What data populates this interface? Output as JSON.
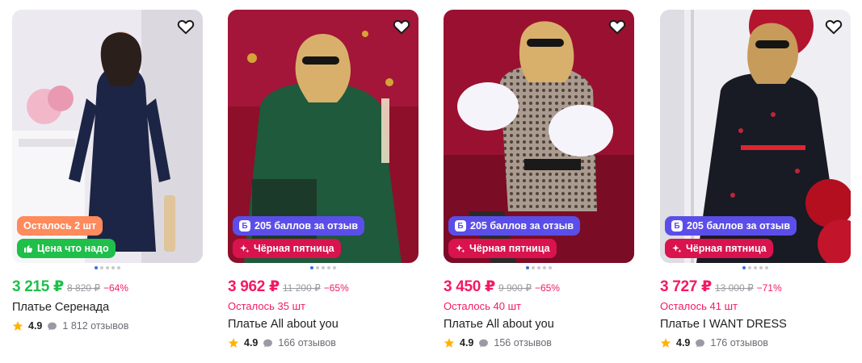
{
  "products": [
    {
      "price": "3 215 ₽",
      "old_price": "8 820 ₽",
      "discount": "−64%",
      "stock_note": "",
      "title": "Платье Серенада",
      "rating": "4.9",
      "reviews": "1 812 отзывов",
      "badges": [
        "Осталось 2 шт",
        "Цена что надо"
      ]
    },
    {
      "price": "3 962 ₽",
      "old_price": "11 200 ₽",
      "discount": "−65%",
      "stock_note": "Осталось 35 шт",
      "title": "Платье All about you",
      "rating": "4.9",
      "reviews": "166 отзывов",
      "badges": [
        "205 баллов за отзыв",
        "Чёрная пятница"
      ]
    },
    {
      "price": "3 450 ₽",
      "old_price": "9 900 ₽",
      "discount": "−65%",
      "stock_note": "Осталось 40 шт",
      "title": "Платье All about you",
      "rating": "4.9",
      "reviews": "156 отзывов",
      "badges": [
        "205 баллов за отзыв",
        "Чёрная пятница"
      ]
    },
    {
      "price": "3 727 ₽",
      "old_price": "13 000 ₽",
      "discount": "−71%",
      "stock_note": "Осталось 41 шт",
      "title": "Платье I WANT DRESS",
      "rating": "4.9",
      "reviews": "176 отзывов",
      "badges": [
        "205 баллов за отзыв",
        "Чёрная пятница"
      ]
    }
  ],
  "icons": {
    "favorite": "heart-outline-icon",
    "rating": "star-icon",
    "reviews": "chat-bubble-icon",
    "points": "b-points-icon",
    "black_friday": "sparkle-icon",
    "good_price": "thumbs-up-icon"
  },
  "colors": {
    "price_green": "#1fbf4a",
    "price_pink": "#f31a62",
    "badge_orange": "#ff8a5c",
    "badge_green": "#1fbf4a",
    "badge_violet": "#5b4ee8",
    "badge_crimson": "#d8134e",
    "star": "#ffb300"
  }
}
